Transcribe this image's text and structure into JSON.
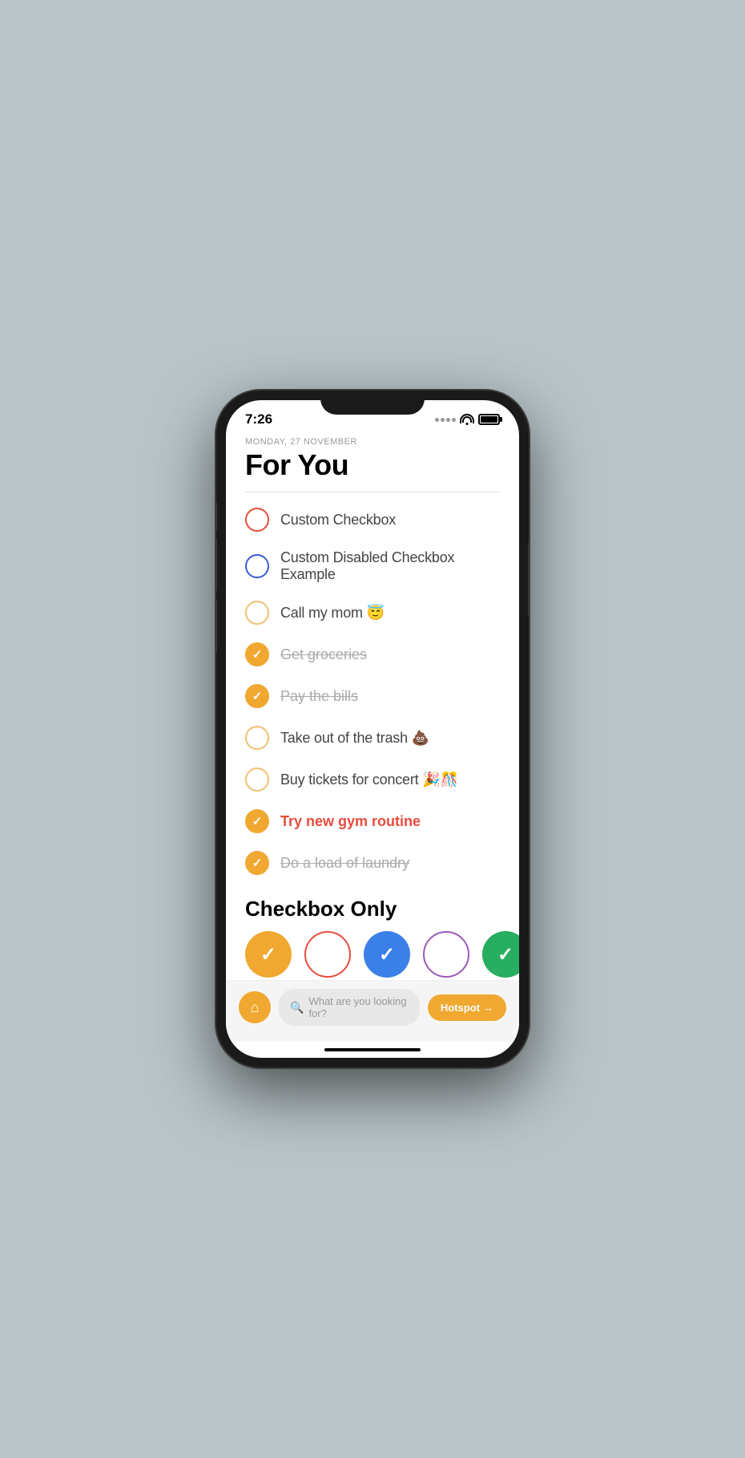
{
  "phone": {
    "status": {
      "time": "7:26",
      "wifi_label": "wifi",
      "battery_label": "battery"
    }
  },
  "header": {
    "date": "MONDAY, 27 NOVEMBER",
    "title": "For You"
  },
  "tasks": [
    {
      "id": 1,
      "text": "Custom Checkbox",
      "checked": false,
      "style": "normal",
      "checkbox_style": "empty-red"
    },
    {
      "id": 2,
      "text": "Custom Disabled Checkbox Example",
      "checked": false,
      "style": "normal",
      "checkbox_style": "empty-blue"
    },
    {
      "id": 3,
      "text": "Call my mom 😇",
      "checked": false,
      "style": "normal",
      "checkbox_style": "empty-orange"
    },
    {
      "id": 4,
      "text": "Get groceries",
      "checked": true,
      "style": "strikethrough",
      "checkbox_style": "filled-orange"
    },
    {
      "id": 5,
      "text": "Pay the bills",
      "checked": true,
      "style": "strikethrough",
      "checkbox_style": "filled-orange"
    },
    {
      "id": 6,
      "text": "Take out of the trash 💩",
      "checked": false,
      "style": "normal",
      "checkbox_style": "empty-orange"
    },
    {
      "id": 7,
      "text": "Buy tickets for concert 🎉🎊",
      "checked": false,
      "style": "normal",
      "checkbox_style": "empty-orange"
    },
    {
      "id": 8,
      "text": "Try new gym routine",
      "checked": true,
      "style": "red",
      "checkbox_style": "filled-orange"
    },
    {
      "id": 9,
      "text": "Do a load of laundry",
      "checked": true,
      "style": "strikethrough",
      "checkbox_style": "filled-orange"
    }
  ],
  "checkbox_section": {
    "title": "Checkbox Only",
    "items": [
      {
        "id": 1,
        "checked": true,
        "style": "orange-filled"
      },
      {
        "id": 2,
        "checked": false,
        "style": "red-empty"
      },
      {
        "id": 3,
        "checked": true,
        "style": "blue-filled"
      },
      {
        "id": 4,
        "checked": false,
        "style": "purple-empty"
      },
      {
        "id": 5,
        "checked": true,
        "style": "green-filled"
      }
    ]
  },
  "bottom_bar": {
    "search_placeholder": "What are you looking for?",
    "hotspot_label": "Hotspot",
    "hotspot_arrow": "→"
  }
}
